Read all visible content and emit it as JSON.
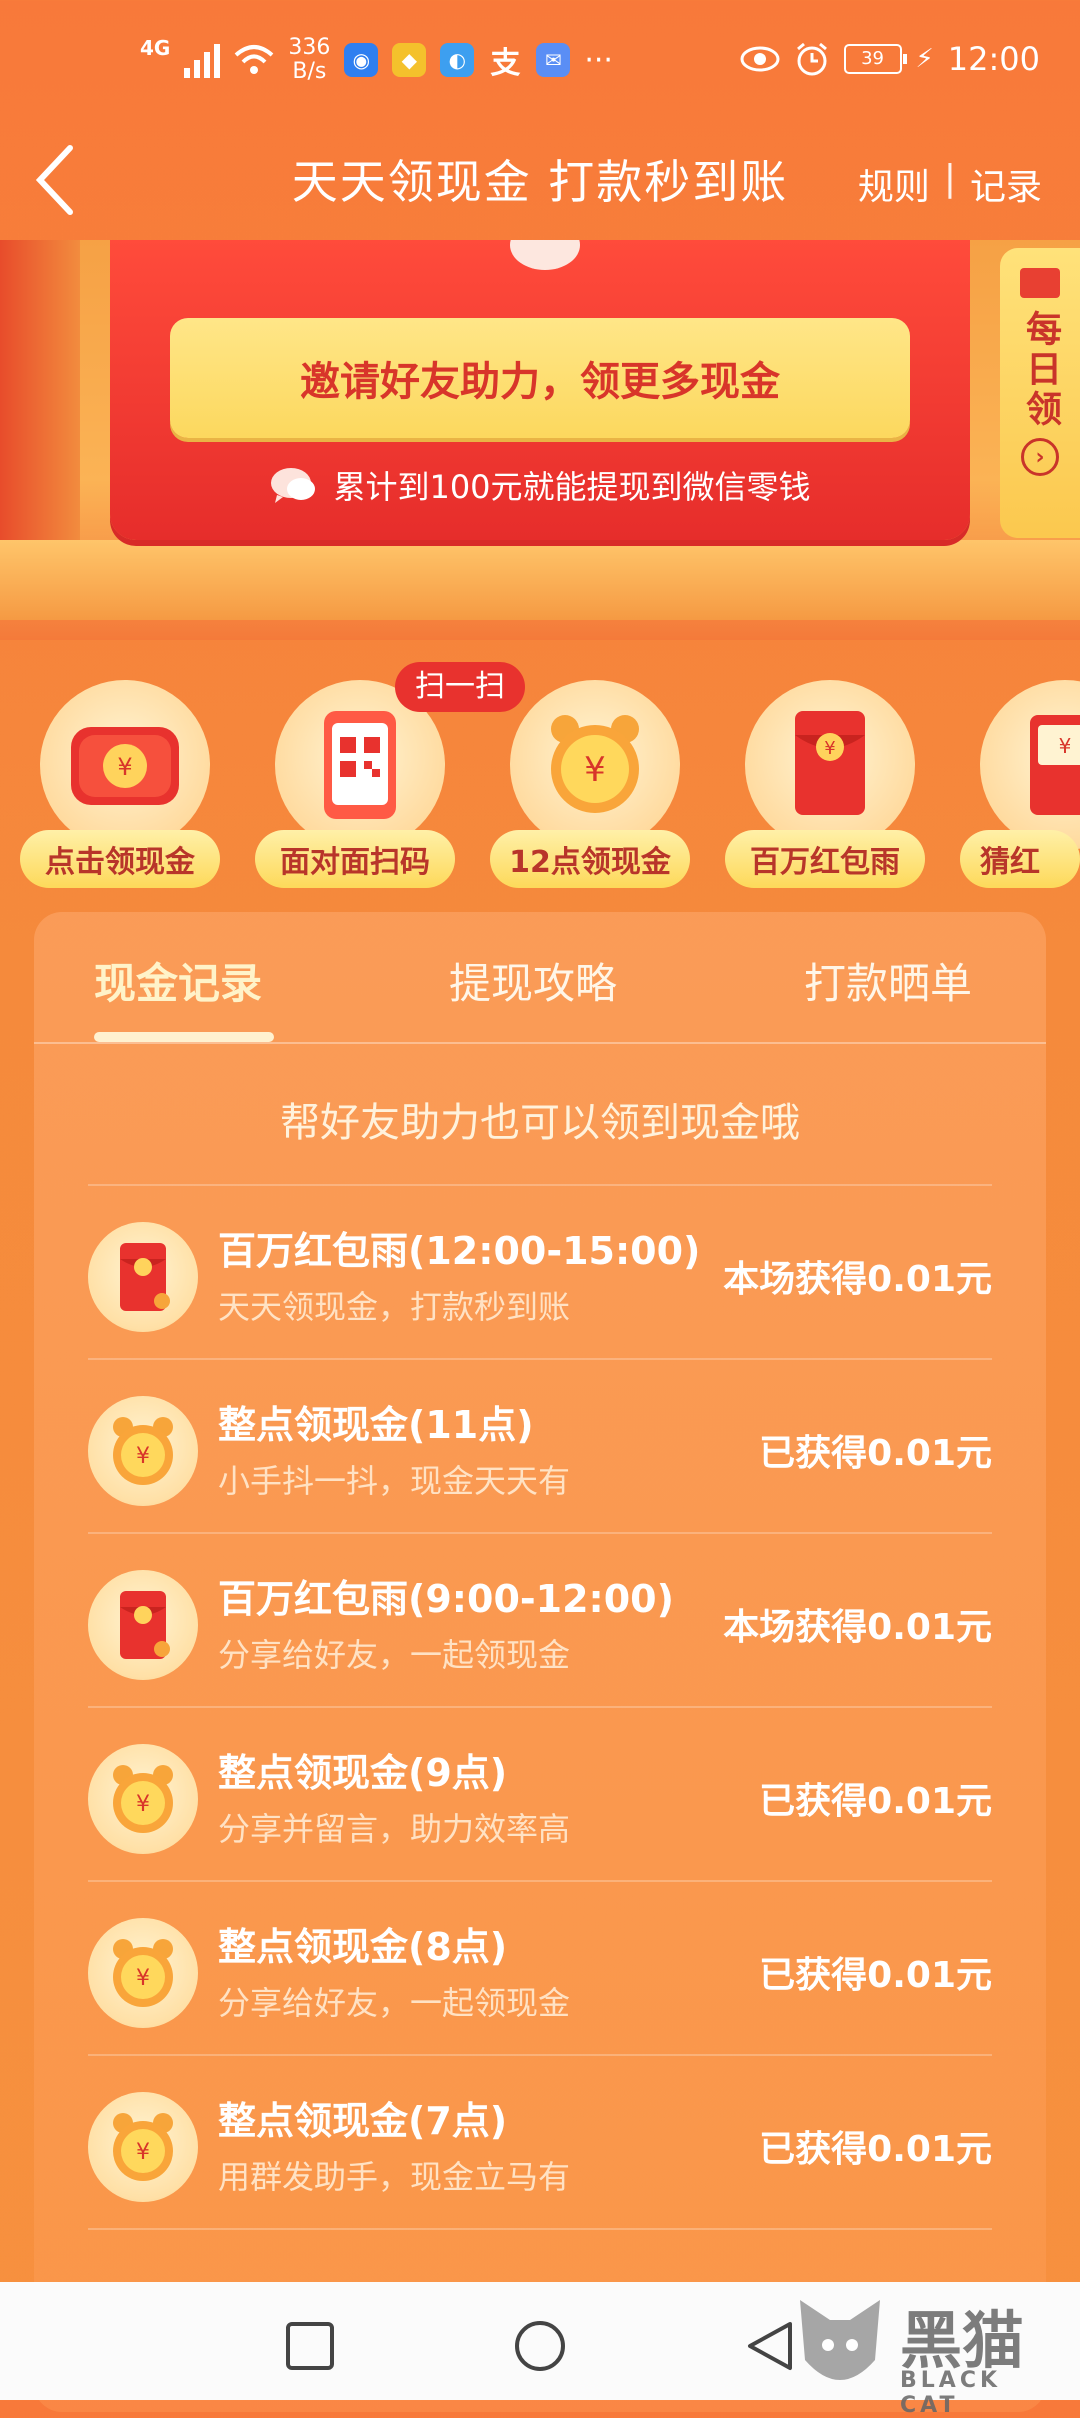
{
  "status_bar": {
    "net_type": "4G",
    "speed_value": "336",
    "speed_unit": "B/s",
    "more": "···",
    "battery": "39",
    "time": "12:00"
  },
  "header": {
    "title": "天天领现金 打款秒到账",
    "rules": "规则",
    "separator": "|",
    "records": "记录"
  },
  "banner": {
    "invite_button": "邀请好友助力，领更多现金",
    "wechat_note": "累计到100元就能提现到微信零钱",
    "daily_tab": "每日领"
  },
  "quick_actions": [
    {
      "label": "点击领现金",
      "icon": "cash-wallet-icon"
    },
    {
      "label": "面对面扫码",
      "icon": "qr-phone-icon"
    },
    {
      "label": "12点领现金",
      "icon": "alarm-clock-icon"
    },
    {
      "label": "百万红包雨",
      "icon": "red-envelope-icon"
    },
    {
      "label": "猜红",
      "icon": "red-envelope-icon"
    }
  ],
  "scan_badge": "扫一扫",
  "tabs": [
    {
      "label": "现金记录",
      "active": true
    },
    {
      "label": "提现攻略",
      "active": false
    },
    {
      "label": "打款晒单",
      "active": false
    }
  ],
  "hint": "帮好友助力也可以领到现金哦",
  "records": [
    {
      "title": "百万红包雨(12:00-15:00)",
      "subtitle": "天天领现金，打款秒到账",
      "amount": "本场获得0.01元",
      "icon": "red-envelope-icon"
    },
    {
      "title": "整点领现金(11点)",
      "subtitle": "小手抖一抖，现金天天有",
      "amount": "已获得0.01元",
      "icon": "alarm-clock-icon"
    },
    {
      "title": "百万红包雨(9:00-12:00)",
      "subtitle": "分享给好友，一起领现金",
      "amount": "本场获得0.01元",
      "icon": "red-envelope-icon"
    },
    {
      "title": "整点领现金(9点)",
      "subtitle": "分享并留言，助力效率高",
      "amount": "已获得0.01元",
      "icon": "alarm-clock-icon"
    },
    {
      "title": "整点领现金(8点)",
      "subtitle": "分享给好友，一起领现金",
      "amount": "已获得0.01元",
      "icon": "alarm-clock-icon"
    },
    {
      "title": "整点领现金(7点)",
      "subtitle": "用群发助手，现金立马有",
      "amount": "已获得0.01元",
      "icon": "alarm-clock-icon"
    }
  ],
  "watermark": {
    "cn": "黑猫",
    "en": "BLACK CAT"
  },
  "colors": {
    "accent": "#f8793a",
    "button_yellow": "#fcd85e",
    "red": "#e62d2b"
  }
}
